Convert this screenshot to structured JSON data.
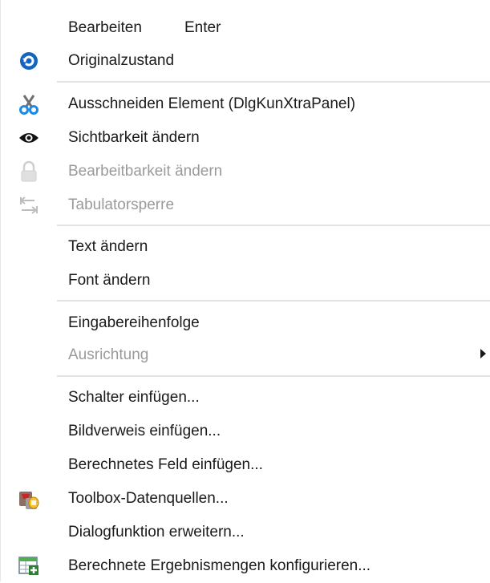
{
  "menu": {
    "items": [
      {
        "label": "Bearbeiten",
        "shortcut": "Enter"
      },
      {
        "label": "Originalzustand",
        "icon": "undo-icon"
      },
      {
        "label": "Ausschneiden Element (DlgKunXtraPanel)",
        "icon": "scissors-icon"
      },
      {
        "label": "Sichtbarkeit ändern",
        "icon": "eye-icon"
      },
      {
        "label": "Bearbeitbarkeit ändern",
        "icon": "lock-icon",
        "disabled": true
      },
      {
        "label": "Tabulatorsperre",
        "icon": "tab-stop-icon",
        "disabled": true
      },
      {
        "label": "Text ändern"
      },
      {
        "label": "Font ändern"
      },
      {
        "label": "Eingabereihenfolge"
      },
      {
        "label": "Ausrichtung",
        "disabled": true,
        "submenu": true
      },
      {
        "label": "Schalter einfügen..."
      },
      {
        "label": "Bildverweis einfügen..."
      },
      {
        "label": "Berechnetes Feld einfügen..."
      },
      {
        "label": "Toolbox-Datenquellen...",
        "icon": "toolbox-datasource-icon"
      },
      {
        "label": "Dialogfunktion erweitern..."
      },
      {
        "label": "Berechnete Ergebnismengen konfigurieren...",
        "icon": "table-add-icon"
      }
    ]
  }
}
